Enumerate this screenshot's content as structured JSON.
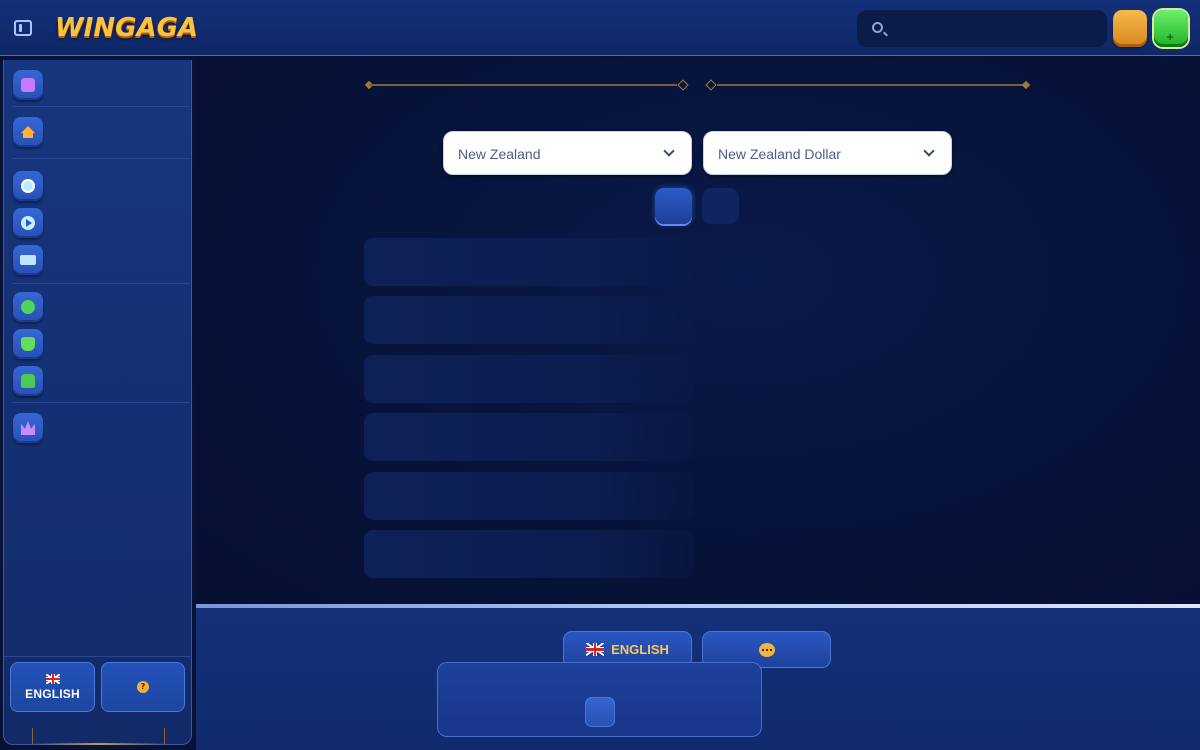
{
  "header": {
    "logo_text": "WINGAGA",
    "search": {
      "placeholder": "",
      "value": ""
    }
  },
  "sidebar": {
    "items": [
      {
        "icon": "gift-icon"
      },
      {
        "icon": "home-icon"
      },
      {
        "icon": "soccer-ball-icon"
      },
      {
        "icon": "play-icon"
      },
      {
        "icon": "ticket-icon"
      },
      {
        "icon": "medal-icon"
      },
      {
        "icon": "trophy-icon"
      },
      {
        "icon": "shopping-bag-icon"
      },
      {
        "icon": "crown-icon"
      }
    ],
    "language_label": "ENGLISH",
    "help_icon": "?"
  },
  "main": {
    "country_select": {
      "value": "New Zealand"
    },
    "currency_select": {
      "value": "New Zealand Dollar"
    }
  },
  "footer": {
    "language_label": "ENGLISH"
  },
  "colors": {
    "accent_gold": "#ffc23a",
    "panel_blue": "#13307a",
    "background": "#071236"
  }
}
